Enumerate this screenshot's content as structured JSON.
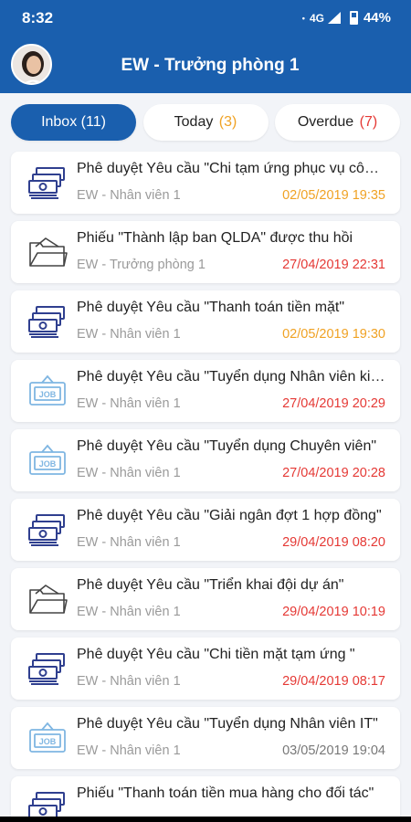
{
  "status_bar": {
    "time": "8:32",
    "network": "4G",
    "battery": "44%"
  },
  "header": {
    "title": "EW - Trưởng phòng 1"
  },
  "tabs": [
    {
      "label": "Inbox (11)",
      "count": "",
      "active": true
    },
    {
      "label": "Today ",
      "count": "(3)",
      "active": false
    },
    {
      "label": "Overdue ",
      "count": "(7)",
      "active": false
    }
  ],
  "items": [
    {
      "icon": "money-icon",
      "title": "Phê duyệt Yêu cầu \"Chi tạm ứng phục vụ công tác\"",
      "sender": "EW - Nhân viên 1",
      "date": "02/05/2019 19:35",
      "date_color": "orange"
    },
    {
      "icon": "folder-icon",
      "title": "Phiếu \"Thành lập ban QLDA\" được thu hồi",
      "sender": "EW - Trưởng phòng 1",
      "date": "27/04/2019 22:31",
      "date_color": "red"
    },
    {
      "icon": "money-icon",
      "title": "Phê duyệt Yêu cầu \"Thanh toán tiền mặt\"",
      "sender": "EW - Nhân viên 1",
      "date": "02/05/2019 19:30",
      "date_color": "orange"
    },
    {
      "icon": "job-icon",
      "title": "Phê duyệt Yêu cầu \"Tuyển dụng Nhân viên kinh doanh\"",
      "sender": "EW - Nhân viên 1",
      "date": "27/04/2019 20:29",
      "date_color": "red"
    },
    {
      "icon": "job-icon",
      "title": "Phê duyệt Yêu cầu \"Tuyển dụng Chuyên viên\"",
      "sender": "EW - Nhân viên 1",
      "date": "27/04/2019 20:28",
      "date_color": "red"
    },
    {
      "icon": "money-icon",
      "title": "Phê duyệt Yêu cầu \"Giải ngân đợt 1 hợp đồng\"",
      "sender": "EW - Nhân viên 1",
      "date": "29/04/2019 08:20",
      "date_color": "red"
    },
    {
      "icon": "folder-icon",
      "title": "Phê duyệt Yêu cầu \"Triển khai đội dự án\"",
      "sender": "EW - Nhân viên 1",
      "date": "29/04/2019 10:19",
      "date_color": "red"
    },
    {
      "icon": "money-icon",
      "title": "Phê duyệt Yêu cầu \"Chi tiền mặt tạm ứng \"",
      "sender": "EW - Nhân viên 1",
      "date": "29/04/2019 08:17",
      "date_color": "red"
    },
    {
      "icon": "job-icon",
      "title": "Phê duyệt Yêu cầu \"Tuyển dụng Nhân viên IT\"",
      "sender": "EW - Nhân viên 1",
      "date": "03/05/2019 19:04",
      "date_color": "grey"
    },
    {
      "icon": "money-icon",
      "title": "Phiếu \"Thanh toán tiền mua hàng cho đối tác\"",
      "sender": "",
      "date": "",
      "date_color": "grey"
    }
  ]
}
